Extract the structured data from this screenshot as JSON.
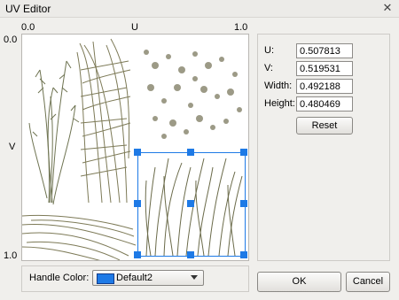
{
  "window": {
    "title": "UV Editor",
    "close_icon": "close-icon"
  },
  "axis": {
    "top_left": "0.0",
    "top_center": "U",
    "top_right": "1.0",
    "left_top": "0.0",
    "left_center": "V",
    "left_bottom": "1.0"
  },
  "fields": {
    "u": {
      "label": "U:",
      "value": "0.507813"
    },
    "v": {
      "label": "V:",
      "value": "0.519531"
    },
    "width": {
      "label": "Width:",
      "value": "0.492188"
    },
    "height": {
      "label": "Height:",
      "value": "0.480469"
    }
  },
  "buttons": {
    "reset": "Reset",
    "ok": "OK",
    "cancel": "Cancel"
  },
  "handle_color": {
    "label": "Handle Color:",
    "selected": "Default2",
    "swatch": "#1e7ae6"
  },
  "colors": {
    "handle": "#1e7ae6",
    "selection_border": "#1e7ae6"
  }
}
